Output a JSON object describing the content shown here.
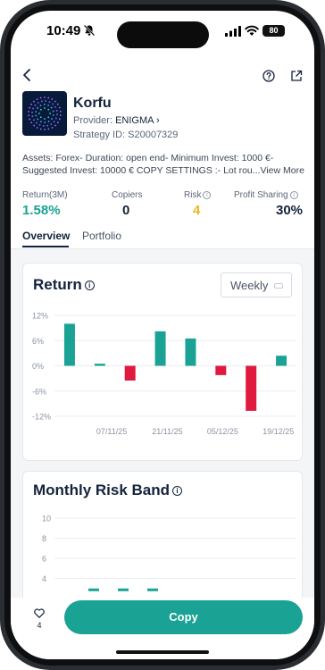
{
  "status_bar": {
    "time": "10:49",
    "battery": "80"
  },
  "strategy": {
    "name": "Korfu",
    "provider_label": "Provider:",
    "provider_name": "ENIGMA",
    "strategy_id": "Strategy ID: S20007329"
  },
  "description": {
    "line1": "Assets: Forex- Duration: open end- Minimum Invest: 1000 €-",
    "line2": "Suggested Invest: 10000 € COPY SETTINGS  :- Lot rou...",
    "view_more": "View More"
  },
  "stats": [
    {
      "label": "Return(3M)",
      "value": "1.58%",
      "color": "#1aa295",
      "has_info": false
    },
    {
      "label": "Copiers",
      "value": "0",
      "color": "#14233c",
      "has_info": false
    },
    {
      "label": "Risk",
      "value": "4",
      "color": "#e8b923",
      "has_info": true
    },
    {
      "label": "Profit Sharing",
      "value": "30%",
      "color": "#14233c",
      "has_info": true
    }
  ],
  "tabs": [
    {
      "label": "Overview",
      "active": true
    },
    {
      "label": "Portfolio",
      "active": false
    }
  ],
  "return_card": {
    "title": "Return",
    "period": "Weekly"
  },
  "risk_card": {
    "title": "Monthly Risk Band"
  },
  "bottom_bar": {
    "favorites": "4",
    "copy_label": "Copy"
  },
  "colors": {
    "positive": "#1aa295",
    "negative": "#e0193f",
    "accent": "#1aa295"
  },
  "chart_data": [
    {
      "type": "bar",
      "title": "Return",
      "y_ticks": [
        "12%",
        "6%",
        "0%",
        "-6%",
        "-12%"
      ],
      "ylim": [
        -12,
        12
      ],
      "x_tick_labels": [
        "07/11/25",
        "21/11/25",
        "05/12/25",
        "19/12/25"
      ],
      "values": [
        10.0,
        0.5,
        -3.5,
        8.2,
        6.5,
        -2.2,
        -10.7,
        2.4
      ],
      "grid": true
    },
    {
      "type": "bar",
      "title": "Monthly Risk Band",
      "y_ticks": [
        "10",
        "8",
        "6",
        "4"
      ],
      "values": [
        3,
        3,
        3
      ],
      "grid": true
    }
  ]
}
